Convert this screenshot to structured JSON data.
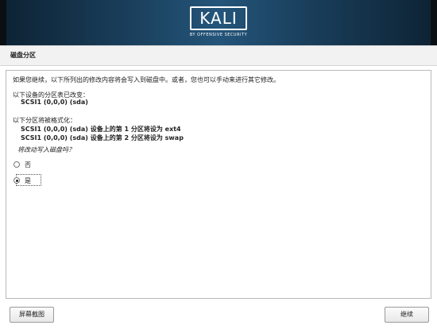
{
  "header": {
    "logo_text": "KALI",
    "logo_subtitle": "BY OFFENSIVE SECURITY"
  },
  "page": {
    "title": "磁盘分区"
  },
  "content": {
    "intro": "如果您继续，以下所列出的修改内容将会写入到磁盘中。或者，您也可以手动来进行其它修改。",
    "changed_label": "以下设备的分区表已改变：",
    "changed_device": "SCSI1 (0,0,0) (sda)",
    "format_label": "以下分区将被格式化：",
    "format_items": [
      "SCSI1 (0,0,0) (sda) 设备上的第 1 分区将设为 ext4",
      "SCSI1 (0,0,0) (sda) 设备上的第 2 分区将设为 swap"
    ],
    "question": "将改动写入磁盘吗？",
    "options": [
      {
        "label": "否",
        "selected": false
      },
      {
        "label": "是",
        "selected": true
      }
    ]
  },
  "footer": {
    "screenshot_label": "屏幕截图",
    "continue_label": "继续"
  }
}
